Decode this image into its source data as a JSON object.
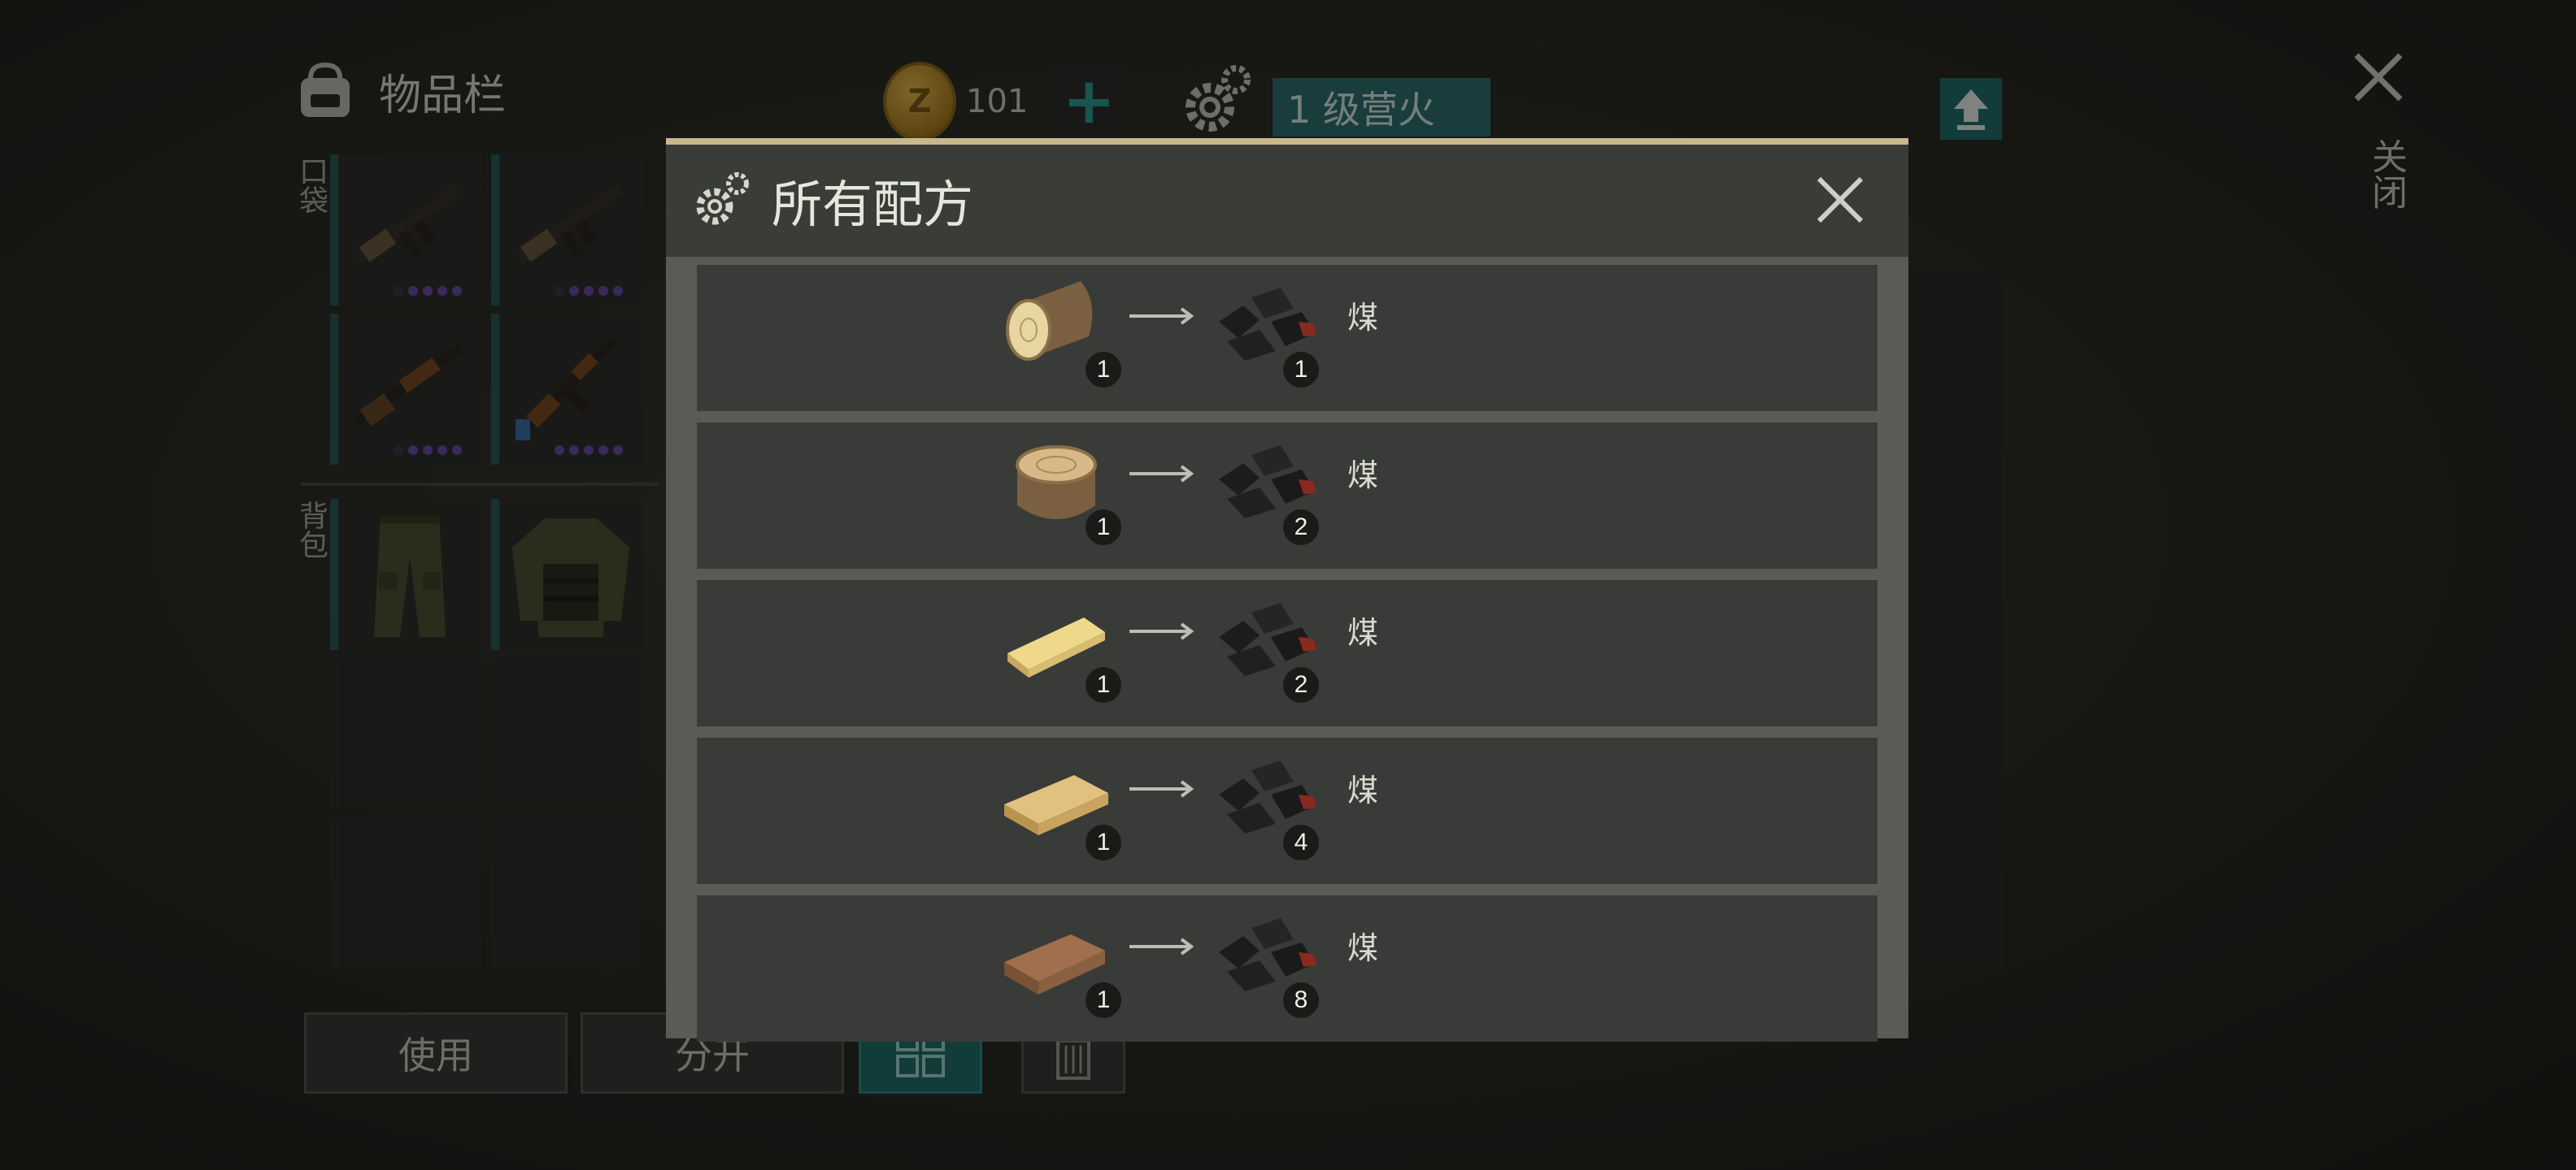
{
  "header": {
    "inventory_title": "物品栏",
    "coins": "101",
    "campfire_level": "1 级营火",
    "close_label": "关闭"
  },
  "sections": {
    "pockets": "口袋",
    "backpack": "背包"
  },
  "bottom_buttons": {
    "use": "使用",
    "split": "分开"
  },
  "modal": {
    "title": "所有配方",
    "recipes": [
      {
        "input_qty": "1",
        "output_qty": "1",
        "output_name": "煤"
      },
      {
        "input_qty": "1",
        "output_qty": "2",
        "output_name": "煤"
      },
      {
        "input_qty": "1",
        "output_qty": "2",
        "output_name": "煤"
      },
      {
        "input_qty": "1",
        "output_qty": "4",
        "output_name": "煤"
      },
      {
        "input_qty": "1",
        "output_qty": "8",
        "output_name": "煤"
      }
    ]
  },
  "icons": [
    "backpack-icon",
    "coin-icon",
    "plus-icon",
    "gears-icon",
    "upload-icon",
    "close-icon",
    "rifle-icon",
    "shotgun-icon",
    "ak-icon",
    "pants-icon",
    "jacket-icon",
    "grid-icon",
    "trash-icon",
    "log-icon",
    "stump-icon",
    "plank-icon",
    "board-icon",
    "coal-icon",
    "arrow-icon"
  ],
  "colors": {
    "accent_teal": "#1f6e6a",
    "coin_gold": "#d4a437",
    "rarity_purple": "#6a4ba8",
    "modal_border": "#c9b88c"
  }
}
